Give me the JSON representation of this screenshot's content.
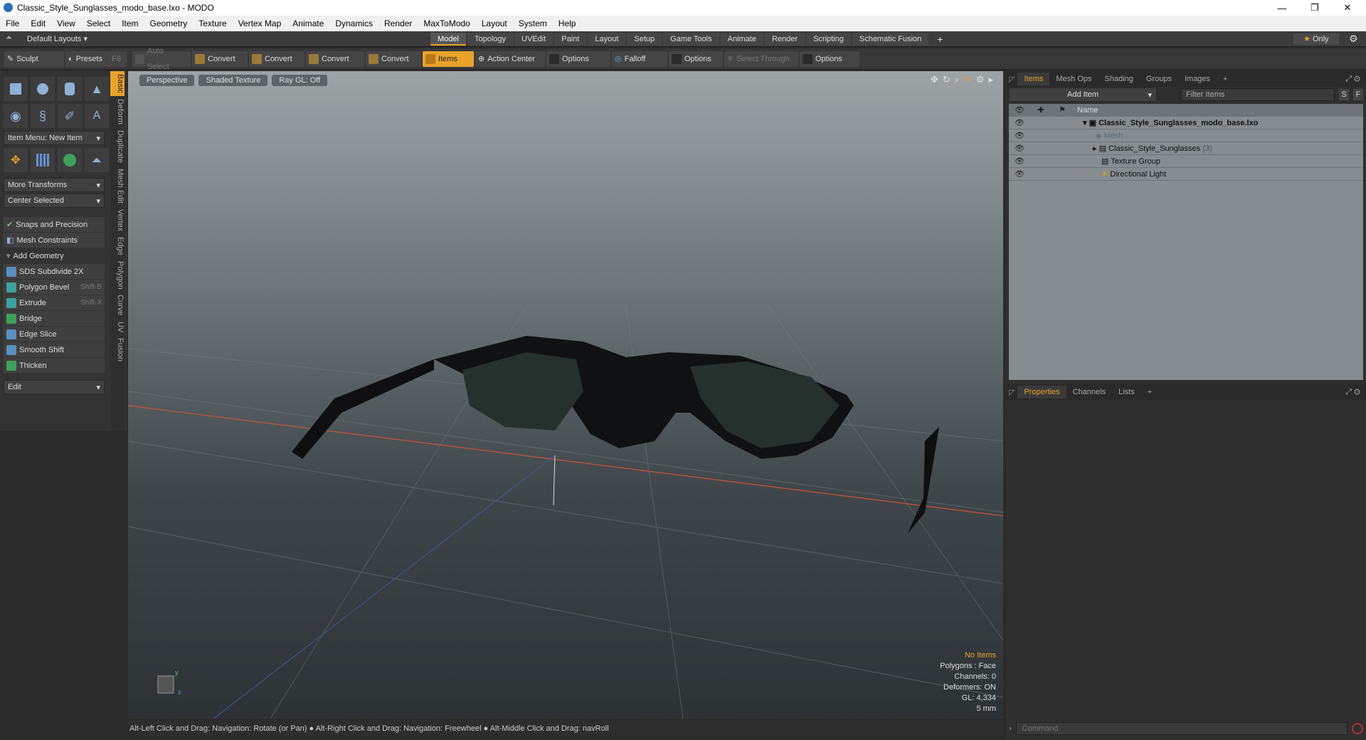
{
  "window": {
    "title": "Classic_Style_Sunglasses_modo_base.lxo - MODO",
    "minimize": "—",
    "restore": "❐",
    "close": "✕"
  },
  "menu": [
    "File",
    "Edit",
    "View",
    "Select",
    "Item",
    "Geometry",
    "Texture",
    "Vertex Map",
    "Animate",
    "Dynamics",
    "Render",
    "MaxToModo",
    "Layout",
    "System",
    "Help"
  ],
  "layouts": {
    "current": "Default Layouts",
    "tabs": [
      "Model",
      "Topology",
      "UVEdit",
      "Paint",
      "Layout",
      "Setup",
      "Game Tools",
      "Animate",
      "Render",
      "Scripting",
      "Schematic Fusion"
    ],
    "active": "Model",
    "add": "+",
    "only": "Only"
  },
  "toolbar": {
    "sculpt": "Sculpt",
    "presets": "Presets",
    "presets_key": "F6",
    "items": [
      {
        "label": "Auto Select",
        "state": "dim"
      },
      {
        "label": "Convert",
        "state": ""
      },
      {
        "label": "Convert",
        "state": ""
      },
      {
        "label": "Convert",
        "state": ""
      },
      {
        "label": "Convert",
        "state": ""
      },
      {
        "label": "Items",
        "state": "on"
      },
      {
        "label": "Action Center",
        "state": ""
      },
      {
        "label": "Options",
        "state": ""
      },
      {
        "label": "Falloff",
        "state": ""
      },
      {
        "label": "Options",
        "state": ""
      },
      {
        "label": "Select Through",
        "state": "dim"
      },
      {
        "label": "Options",
        "state": ""
      }
    ]
  },
  "left": {
    "item_menu": "Item Menu: New Item",
    "more_transforms": "More Transforms",
    "center_selected": "Center Selected",
    "snaps": "Snaps and Precision",
    "constraints": "Mesh Constraints",
    "add_geometry": "Add Geometry",
    "tools": [
      {
        "label": "SDS Subdivide 2X",
        "key": ""
      },
      {
        "label": "Polygon Bevel",
        "key": "Shift-B"
      },
      {
        "label": "Extrude",
        "key": "Shift-X"
      },
      {
        "label": "Bridge",
        "key": ""
      },
      {
        "label": "Edge Slice",
        "key": ""
      },
      {
        "label": "Smooth Shift",
        "key": ""
      },
      {
        "label": "Thicken",
        "key": ""
      }
    ],
    "edit": "Edit",
    "vtabs": [
      "Basic",
      "Deform",
      "Duplicate",
      "Mesh Edit",
      "Vertex",
      "Edge",
      "Polygon",
      "Curve",
      "UV",
      "Fusion"
    ]
  },
  "viewport": {
    "perspective": "Perspective",
    "shading": "Shaded Texture",
    "raygl": "Ray GL: Off",
    "info": {
      "items": "No Items",
      "polygons": "Polygons : Face",
      "channels": "Channels: 0",
      "deformers": "Deformers: ON",
      "gl": "GL: 4,334",
      "scale": "5 mm"
    }
  },
  "status": "Alt-Left Click and Drag: Navigation: Rotate (or Pan) ● Alt-Right Click and Drag: Navigation: Freewheel ● Alt-Middle Click and Drag: navRoll",
  "right": {
    "tabs": [
      "Items",
      "Mesh Ops",
      "Shading",
      "Groups",
      "Images"
    ],
    "add_item": "Add Item",
    "filter": "Filter Items",
    "s": "S",
    "f": "F",
    "name_col": "Name",
    "tree": [
      {
        "label": "Classic_Style_Sunglasses_modo_base.lxo",
        "indent": 0,
        "bold": true,
        "dim": false,
        "count": ""
      },
      {
        "label": "Mesh",
        "indent": 2,
        "bold": false,
        "dim": true,
        "count": ""
      },
      {
        "label": "Classic_Style_Sunglasses",
        "indent": 2,
        "bold": false,
        "dim": false,
        "count": "(3)"
      },
      {
        "label": "Texture Group",
        "indent": 2,
        "bold": false,
        "dim": false,
        "count": ""
      },
      {
        "label": "Directional Light",
        "indent": 2,
        "bold": false,
        "dim": false,
        "count": ""
      }
    ],
    "props_tabs": [
      "Properties",
      "Channels",
      "Lists"
    ],
    "command_placeholder": "Command"
  },
  "colors": {
    "accent": "#e8a32b"
  }
}
